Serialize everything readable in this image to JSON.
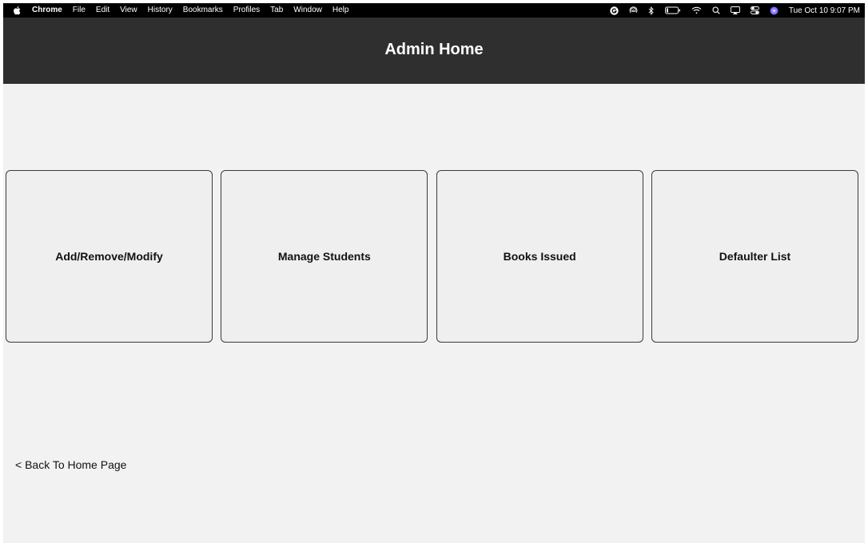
{
  "menubar": {
    "app_name": "Chrome",
    "items": [
      "File",
      "Edit",
      "View",
      "History",
      "Bookmarks",
      "Profiles",
      "Tab",
      "Window",
      "Help"
    ],
    "clock": "Tue Oct 10  9:07 PM"
  },
  "header": {
    "title": "Admin Home"
  },
  "cards": [
    {
      "label": "Add/Remove/Modify"
    },
    {
      "label": "Manage Students"
    },
    {
      "label": "Books Issued"
    },
    {
      "label": "Defaulter List"
    }
  ],
  "footer": {
    "back_link": "< Back To Home Page"
  },
  "colors": {
    "header_bg": "#2f2f2f",
    "content_bg": "#f2f2f2",
    "card_border": "#3a3a3a"
  }
}
